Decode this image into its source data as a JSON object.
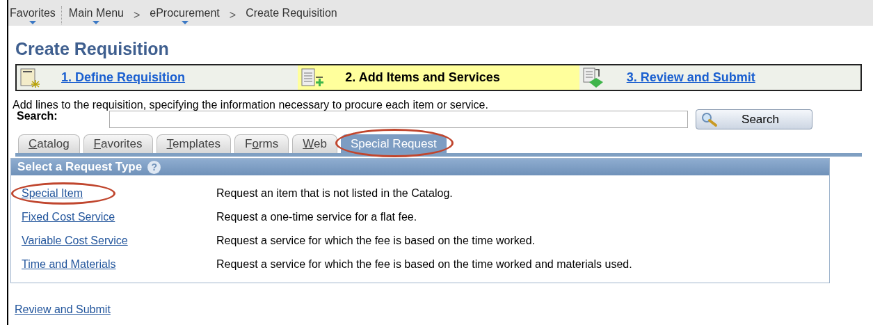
{
  "breadcrumbs": [
    {
      "label": "Favorites",
      "dropdown": true
    },
    {
      "label": "Main Menu",
      "dropdown": true
    },
    {
      "label": "eProcurement",
      "dropdown": true
    },
    {
      "label": "Create Requisition",
      "dropdown": false
    }
  ],
  "separator": ">",
  "title": "Create Requisition",
  "steps": [
    {
      "label": "1. Define Requisition",
      "selected": false,
      "kind": "define"
    },
    {
      "label": "2. Add Items and Services",
      "selected": true,
      "kind": "add"
    },
    {
      "label": "3. Review and Submit",
      "selected": false,
      "kind": "review"
    }
  ],
  "description": "Add lines to the requisition, specifying the information necessary to procure each item or service.",
  "search": {
    "label": "Search:",
    "button": "Search"
  },
  "tabs": [
    {
      "key": "C",
      "after": "atalog",
      "selected": false,
      "highlighted": false
    },
    {
      "key": "F",
      "after": "avorites",
      "selected": false,
      "highlighted": false
    },
    {
      "key": "T",
      "after": "emplates",
      "selected": false,
      "highlighted": false
    },
    {
      "before": "F",
      "key": "o",
      "after": "rms",
      "selected": false,
      "highlighted": false
    },
    {
      "key": "W",
      "after": "eb",
      "selected": false,
      "highlighted": false
    },
    {
      "before": "Special Request",
      "selected": true,
      "highlighted": true
    }
  ],
  "panel": {
    "title": "Select a Request Type",
    "help": "?",
    "rows": [
      {
        "link": "Special Item",
        "description": "Request an item that is not listed in the Catalog.",
        "highlighted": true
      },
      {
        "link": "Fixed Cost Service",
        "description": "Request a one-time service for a flat fee.",
        "highlighted": false
      },
      {
        "link": "Variable Cost Service",
        "description": "Request a service for which the fee is based on the time worked.",
        "highlighted": false
      },
      {
        "link": "Time and Materials",
        "description": "Request a service for which the fee is based on the time worked and materials used.",
        "highlighted": false
      }
    ]
  },
  "footer_link": "Review and Submit"
}
